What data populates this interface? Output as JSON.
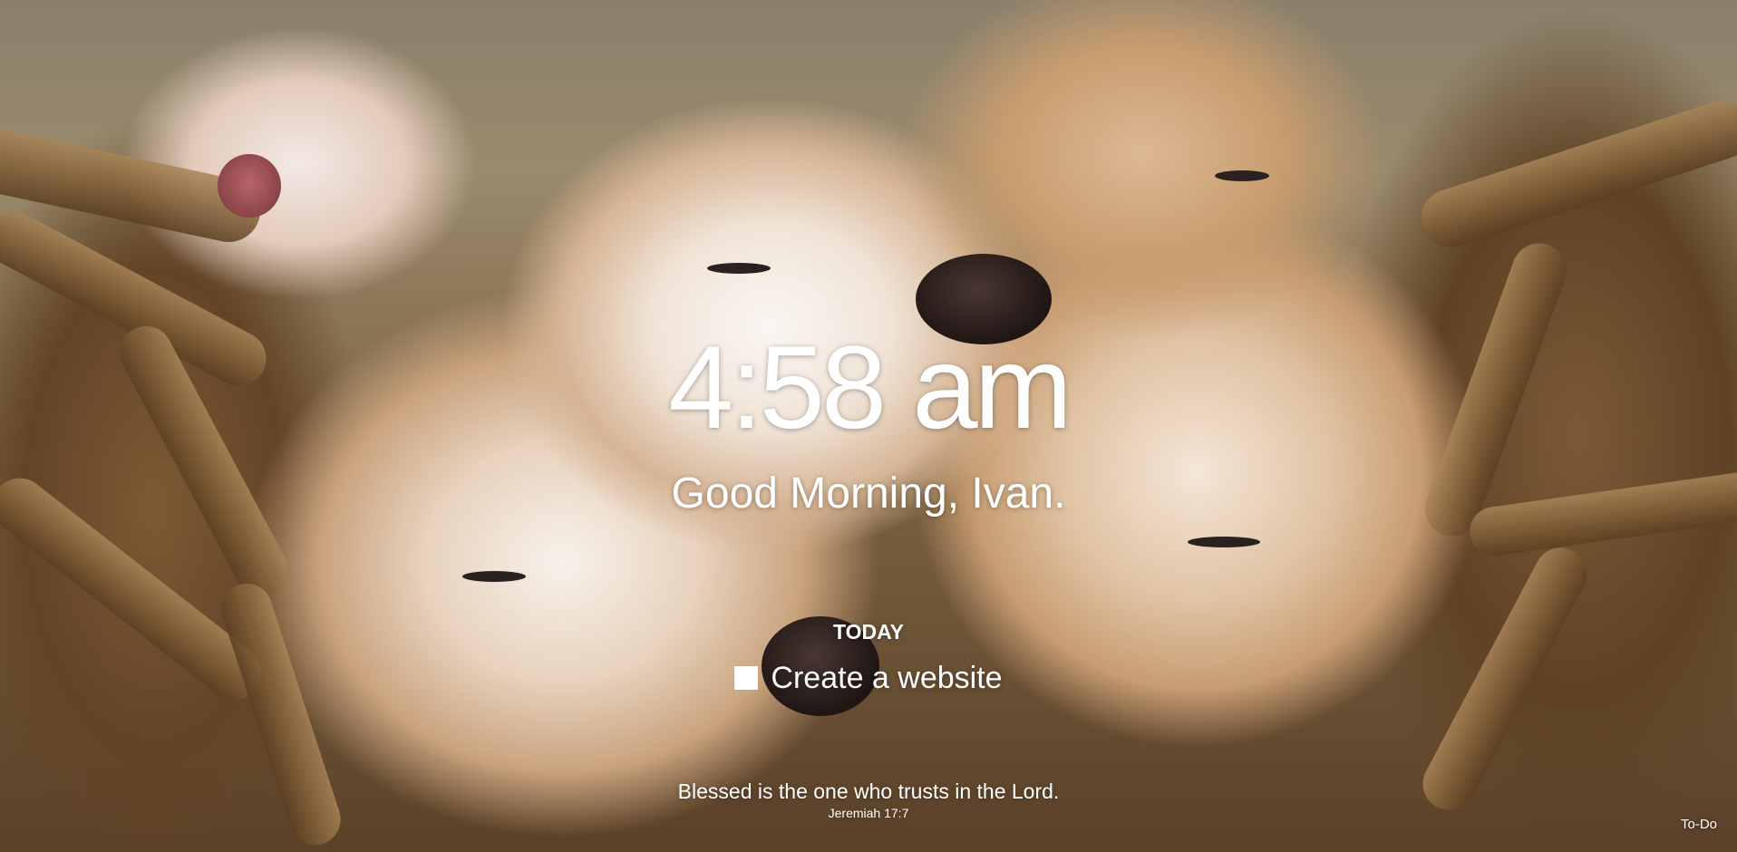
{
  "clock": {
    "time": "4:58 am"
  },
  "greeting": {
    "text": "Good Morning, Ivan."
  },
  "focus": {
    "heading": "TODAY",
    "task": "Create a website",
    "completed": false
  },
  "quote": {
    "text": "Blessed is the one who trusts in the Lord.",
    "source": "Jeremiah 17:7"
  },
  "footer": {
    "todo_label": "To-Do"
  }
}
